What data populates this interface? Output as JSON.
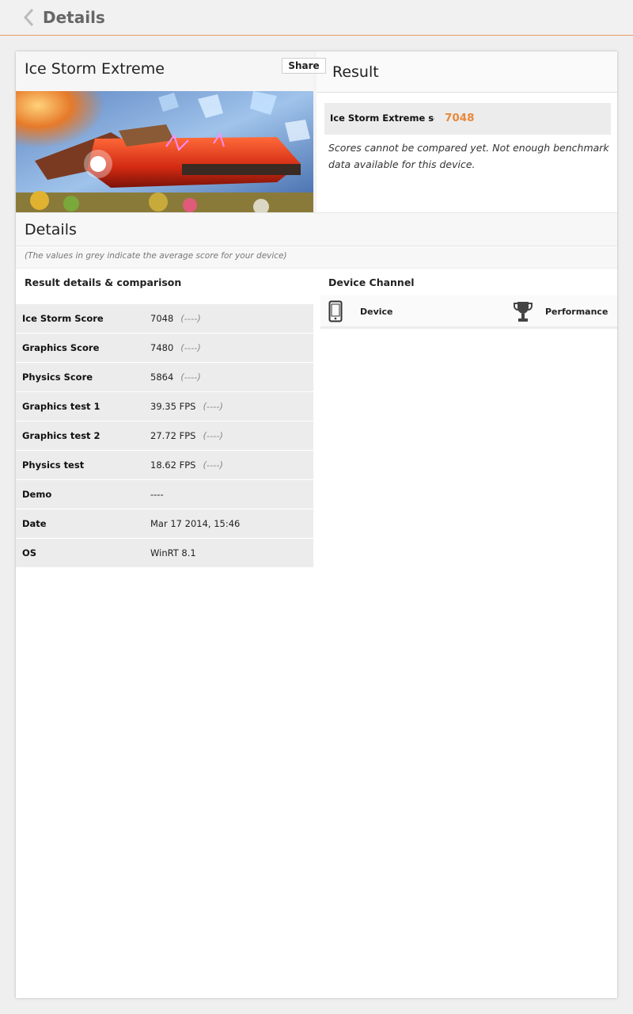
{
  "header": {
    "title": "Details"
  },
  "benchmark": {
    "title": "Ice Storm Extreme"
  },
  "result": {
    "title": "Result",
    "share_label": "Share",
    "score_label": "Ice Storm Extreme score",
    "score_value": "7048",
    "note": "Scores cannot be compared yet. Not enough benchmark data available for this device."
  },
  "details": {
    "title": "Details",
    "subnote": "(The values in grey indicate the average score for your device)",
    "section_title": "Result details & comparison",
    "rows": [
      {
        "label": "Ice Storm Score",
        "value": "7048",
        "avg": "(----)"
      },
      {
        "label": "Graphics Score",
        "value": "7480",
        "avg": "(----)"
      },
      {
        "label": "Physics Score",
        "value": "5864",
        "avg": "(----)"
      },
      {
        "label": "Graphics test 1",
        "value": "39.35 FPS",
        "avg": "(----)"
      },
      {
        "label": "Graphics test 2",
        "value": "27.72 FPS",
        "avg": "(----)"
      },
      {
        "label": "Physics test",
        "value": "18.62 FPS",
        "avg": "(----)"
      },
      {
        "label": "Demo",
        "value": "----",
        "avg": ""
      },
      {
        "label": "Date",
        "value": "Mar 17 2014, 15:46",
        "avg": ""
      },
      {
        "label": "OS",
        "value": "WinRT 8.1",
        "avg": ""
      }
    ]
  },
  "device_channel": {
    "title": "Device Channel",
    "device_label": "Device",
    "performance_label": "Performance"
  },
  "colors": {
    "accent": "#e8893a",
    "header_rule": "#e89a62",
    "row_bg": "#ececec"
  }
}
